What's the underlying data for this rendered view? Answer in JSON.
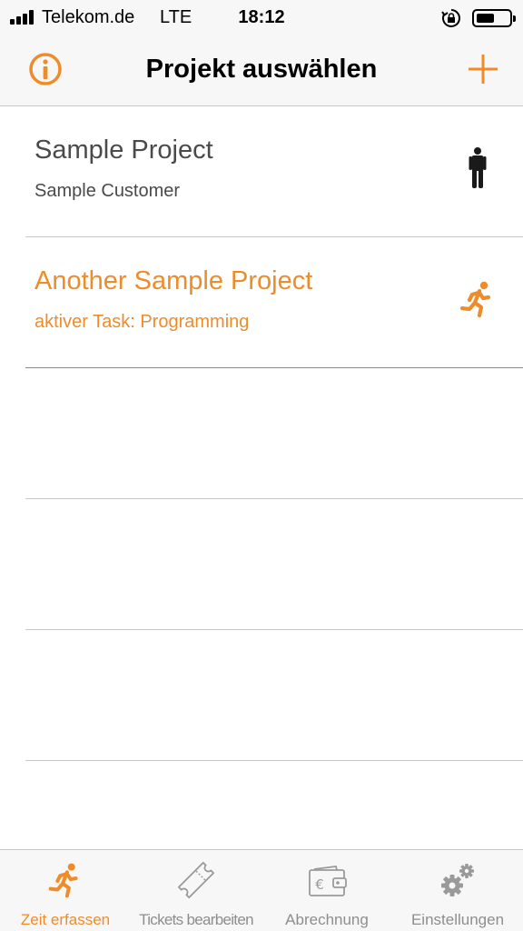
{
  "status_bar": {
    "carrier": "Telekom.de",
    "network": "LTE",
    "time": "18:12"
  },
  "nav": {
    "title": "Projekt auswählen",
    "left_icon": "info-icon",
    "right_icon": "plus-icon"
  },
  "projects": [
    {
      "title": "Sample Project",
      "subtitle": "Sample Customer",
      "status_icon": "standing-person-icon",
      "state": "idle"
    },
    {
      "title": "Another Sample Project",
      "subtitle": "aktiver Task: Programming",
      "status_icon": "running-person-icon",
      "state": "running"
    }
  ],
  "tabs": [
    {
      "label": "Zeit erfassen",
      "icon": "running-person-icon",
      "active": true
    },
    {
      "label": "Tickets bearbeiten",
      "icon": "ticket-icon",
      "active": false
    },
    {
      "label": "Abrechnung",
      "icon": "wallet-euro-icon",
      "active": false
    },
    {
      "label": "Einstellungen",
      "icon": "gears-icon",
      "active": false
    }
  ],
  "colors": {
    "accent": "#EF8C2A",
    "text_dark": "#4A4A4A",
    "inactive": "#8E8E8E",
    "bar_background": "#F7F7F7"
  }
}
